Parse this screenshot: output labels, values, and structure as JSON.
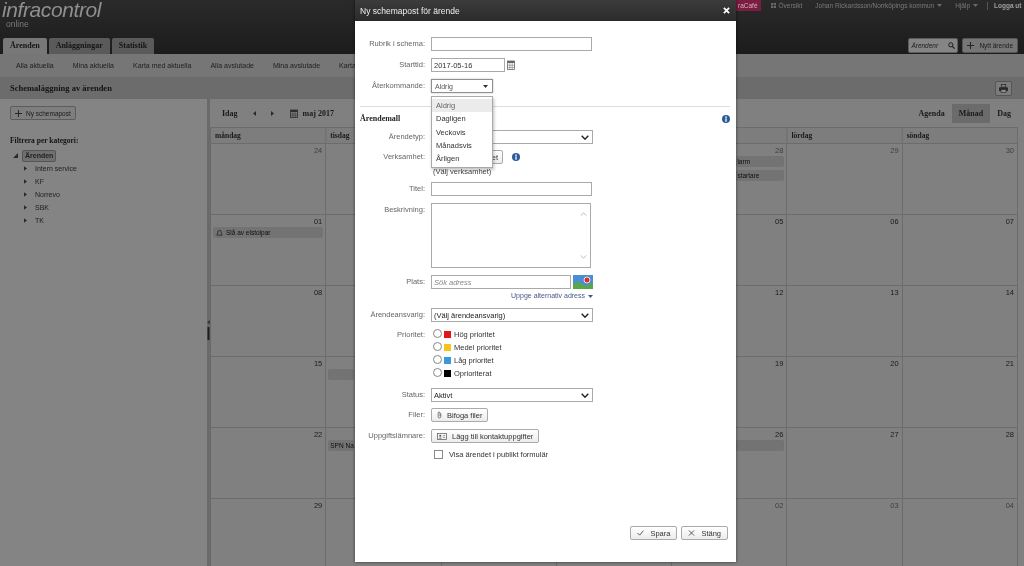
{
  "header": {
    "logo": "infracontrol",
    "logo_sub": "online",
    "links": [
      {
        "kind": "cafe",
        "label": "raCafé"
      },
      {
        "kind": "overview",
        "label": "Översikt"
      },
      {
        "kind": "user",
        "label": "Johan Rickardsson/Norrköpings kommun"
      },
      {
        "kind": "help",
        "label": "Hjälp"
      },
      {
        "kind": "logout",
        "label": "Logga ut"
      }
    ]
  },
  "tabs": [
    {
      "label": "Ärenden",
      "selected": true
    },
    {
      "label": "Anläggningar",
      "selected": false
    },
    {
      "label": "Statistik",
      "selected": false
    }
  ],
  "search": {
    "placeholder": "Ärendenr"
  },
  "new_case_button": "Nytt ärende",
  "subnav": [
    "Alla aktuella",
    "Mina aktuella",
    "Karta med aktuella",
    "Alla avslutade",
    "Mina avslutade",
    "Karta"
  ],
  "page_title": "Schemaläggning av ärenden",
  "sidebar": {
    "new_button": "Ny schemapost",
    "filter_title": "Filtrera per kategori:",
    "tree": [
      {
        "label": "Ärenden",
        "expanded": true,
        "selected": true,
        "children": [
          {
            "label": "Intern service",
            "expanded": false,
            "selected": false
          },
          {
            "label": "KF",
            "expanded": false,
            "selected": false
          },
          {
            "label": "Norrevo",
            "expanded": false,
            "selected": false
          },
          {
            "label": "SBK",
            "expanded": false,
            "selected": false
          },
          {
            "label": "TK",
            "expanded": false,
            "selected": false
          }
        ]
      }
    ]
  },
  "calendar": {
    "today": "Idag",
    "month": "maj 2017",
    "views": [
      {
        "label": "Agenda",
        "selected": false
      },
      {
        "label": "Månad",
        "selected": true
      },
      {
        "label": "Dag",
        "selected": false
      }
    ],
    "day_headers": {
      "monday": "måndag",
      "tuesday": "tisdag",
      "saturday": "lördag",
      "sunday": "söndag"
    },
    "weeks": [
      {
        "monday": {
          "date": "24",
          "other_month": true
        },
        "friday": {
          "date": "28",
          "other_month": true,
          "events": [
            {
              "text": "larm",
              "icon": false
            },
            {
              "text": "startare",
              "icon": false
            }
          ]
        },
        "saturday": {
          "date": "29",
          "other_month": true
        },
        "sunday": {
          "date": "30",
          "other_month": true
        }
      },
      {
        "monday": {
          "date": "01",
          "other_month": false,
          "events": [
            {
              "text": "Slå av elstolpar",
              "icon": true
            }
          ]
        },
        "friday": {
          "date": "05",
          "other_month": false
        },
        "saturday": {
          "date": "06",
          "other_month": false
        },
        "sunday": {
          "date": "07",
          "other_month": false
        }
      },
      {
        "monday": {
          "date": "08",
          "other_month": false
        },
        "friday": {
          "date": "12",
          "other_month": false
        },
        "saturday": {
          "date": "13",
          "other_month": false
        },
        "sunday": {
          "date": "14",
          "other_month": false
        }
      },
      {
        "monday": {
          "date": "15",
          "other_month": false
        },
        "tuesday": {
          "events": [
            {
              "icon": false
            }
          ]
        },
        "friday": {
          "date": "19",
          "other_month": false
        },
        "saturday": {
          "date": "20",
          "other_month": false
        },
        "sunday": {
          "date": "21",
          "other_month": false
        }
      },
      {
        "monday": {
          "date": "22",
          "other_month": false
        },
        "tuesday": {
          "events": [
            {
              "text": "SPN Na",
              "icon": false
            }
          ]
        },
        "friday": {
          "date": "26",
          "other_month": false,
          "events": [
            {
              "icon": false
            }
          ]
        },
        "saturday": {
          "date": "27",
          "other_month": false
        },
        "sunday": {
          "date": "28",
          "other_month": false
        }
      },
      {
        "monday": {
          "date": "29",
          "other_month": false
        },
        "friday": {
          "date": "02",
          "other_month": true
        },
        "saturday": {
          "date": "03",
          "other_month": true
        },
        "sunday": {
          "date": "04",
          "other_month": true
        }
      }
    ]
  },
  "dialog": {
    "title": "Ny schemapost för ärende",
    "fields": [
      {
        "kind": "text",
        "label": "Rubrik i schema:"
      },
      {
        "kind": "date",
        "label": "Starttid:",
        "value": "2017-05-16"
      },
      {
        "kind": "dropdown",
        "label": "Återkommande:",
        "value": "Aldrig",
        "expanded": true,
        "options": [
          {
            "label": "Aldrig",
            "selected": true
          },
          {
            "label": "Dagligen",
            "selected": false
          },
          {
            "label": "Veckovis",
            "selected": false
          },
          {
            "label": "Månadsvis",
            "selected": false
          },
          {
            "label": "Årligen",
            "selected": false
          }
        ]
      },
      {
        "kind": "section",
        "title": "Ärendemall"
      },
      {
        "kind": "select",
        "label": "Ärendetyp:"
      },
      {
        "kind": "picker",
        "label": "Verksamhet:",
        "button": "et",
        "note": "(Välj verksamhet)"
      },
      {
        "kind": "text",
        "label": "Titel:"
      },
      {
        "kind": "textarea",
        "label": "Beskrivning:"
      },
      {
        "kind": "address",
        "label": "Plats:",
        "placeholder": "Sök adress",
        "link": "Uppge alternativ adress"
      },
      {
        "kind": "select",
        "label": "Ärendeansvarig:",
        "value": "(Välj ärendeansvarig)"
      },
      {
        "kind": "radio",
        "label": "Prioritet:",
        "options": [
          {
            "label": "Hög prioritet",
            "color": "#e4141b",
            "selected": false
          },
          {
            "label": "Medel prioritet",
            "color": "#f5c31c",
            "selected": false
          },
          {
            "label": "Låg prioritet",
            "color": "#3a9ad9",
            "selected": false
          },
          {
            "label": "Oprioriterat",
            "color": "#000000",
            "selected": false
          }
        ]
      },
      {
        "kind": "select",
        "label": "Status:",
        "value": "Aktivt"
      },
      {
        "kind": "attach",
        "label": "Filer:",
        "button": "Bifoga filer"
      },
      {
        "kind": "contact",
        "label": "Uppgiftslämnare:",
        "button": "Lägg till kontaktuppgifter"
      },
      {
        "kind": "checkbox",
        "text": "Visa ärendet i publikt formulär",
        "checked": false
      }
    ],
    "buttons": [
      {
        "kind": "save",
        "label": "Spara"
      },
      {
        "kind": "close",
        "label": "Stäng"
      }
    ]
  }
}
